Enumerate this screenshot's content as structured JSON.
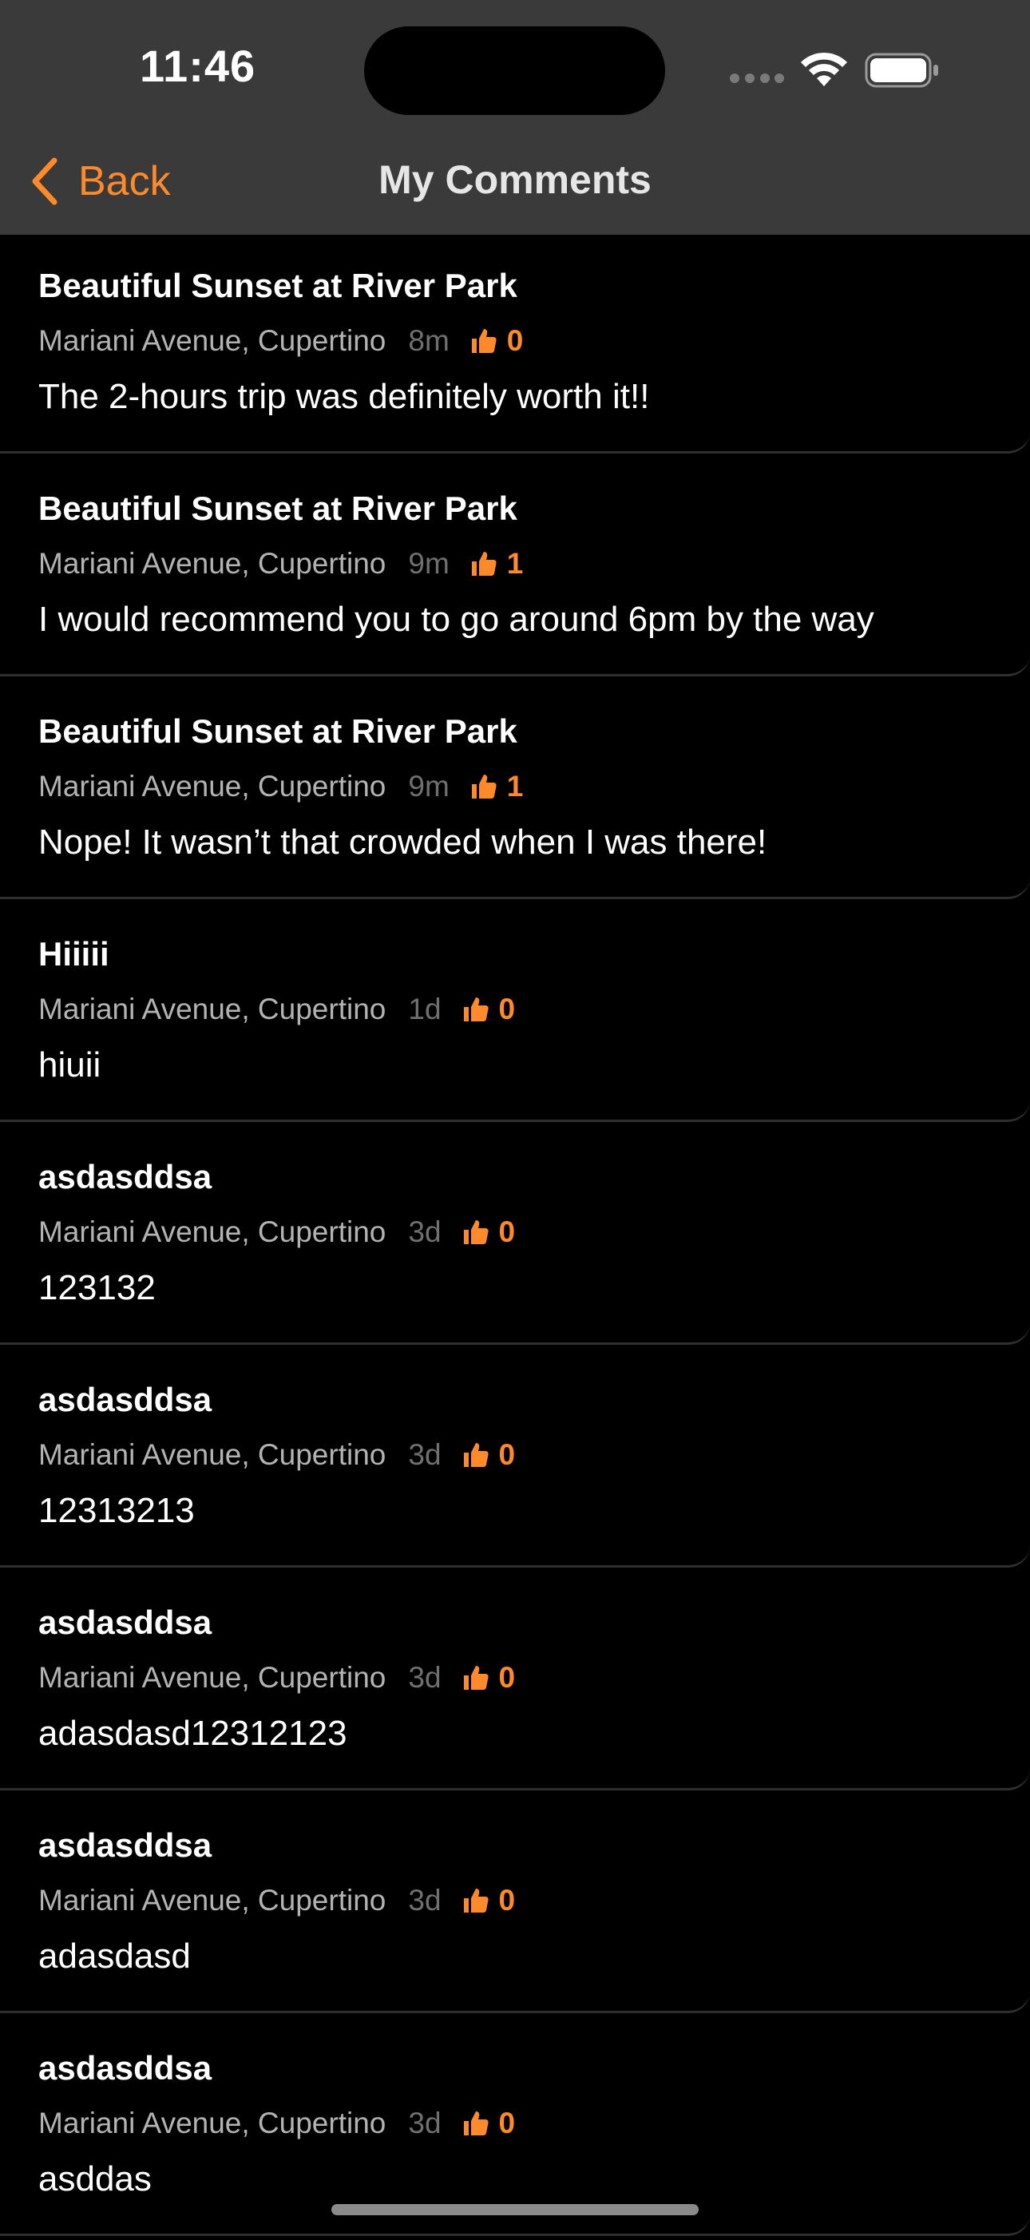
{
  "status_bar": {
    "time": "11:46"
  },
  "nav": {
    "back_label": "Back",
    "title": "My Comments"
  },
  "colors": {
    "accent": "#ff8a2b",
    "header_bg": "#3a3a3a",
    "background": "#000000"
  },
  "comments": [
    {
      "title": "Beautiful Sunset at River Park",
      "location": "Mariani Avenue, Cupertino",
      "time": "8m",
      "likes": "0",
      "text": "The 2-hours trip was definitely worth it!!"
    },
    {
      "title": "Beautiful Sunset at River Park",
      "location": "Mariani Avenue, Cupertino",
      "time": "9m",
      "likes": "1",
      "text": "I would recommend you to go around 6pm by the way"
    },
    {
      "title": "Beautiful Sunset at River Park",
      "location": "Mariani Avenue, Cupertino",
      "time": "9m",
      "likes": "1",
      "text": "Nope! It wasn’t that crowded when I was there!"
    },
    {
      "title": "Hiiiii",
      "location": "Mariani Avenue, Cupertino",
      "time": "1d",
      "likes": "0",
      "text": "hiuii"
    },
    {
      "title": "asdasddsa",
      "location": "Mariani Avenue, Cupertino",
      "time": "3d",
      "likes": "0",
      "text": "123132"
    },
    {
      "title": "asdasddsa",
      "location": "Mariani Avenue, Cupertino",
      "time": "3d",
      "likes": "0",
      "text": "12313213"
    },
    {
      "title": "asdasddsa",
      "location": "Mariani Avenue, Cupertino",
      "time": "3d",
      "likes": "0",
      "text": "adasdasd12312123"
    },
    {
      "title": "asdasddsa",
      "location": "Mariani Avenue, Cupertino",
      "time": "3d",
      "likes": "0",
      "text": "adasdasd"
    },
    {
      "title": "asdasddsa",
      "location": "Mariani Avenue, Cupertino",
      "time": "3d",
      "likes": "0",
      "text": "asddas"
    }
  ]
}
